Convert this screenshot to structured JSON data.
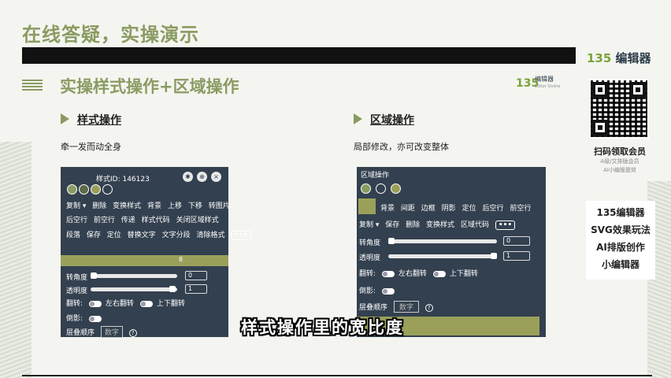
{
  "header": {
    "title": "在线答疑，实操演示"
  },
  "brand": {
    "num": "135",
    "name": "编辑器"
  },
  "section": {
    "title": "实操样式操作+区域操作"
  },
  "mini_logo": {
    "num": "135",
    "name": "编辑器",
    "en": "Editor Online"
  },
  "qr": {
    "caption": "扫码领取会员",
    "sub1": "A级/文排版会员",
    "sub2": "AI小编版提效"
  },
  "features": [
    "135编辑器",
    "SVG效果玩法",
    "AI排版创作",
    "小编辑器"
  ],
  "left": {
    "heading": "样式操作",
    "desc": "牵一发而动全身",
    "panel": {
      "style_id": "样式ID: 146123",
      "row1": [
        "复制 ▾",
        "删除",
        "变换样式",
        "背景",
        "上移",
        "下移",
        "转图片"
      ],
      "row2": [
        "后空行",
        "前空行",
        "传递",
        "样式代码",
        "关闭区域样式"
      ],
      "row3": [
        "段落",
        "保存",
        "定位",
        "替换文字",
        "文字分段",
        "清除格式"
      ],
      "more": "•••",
      "olive_num": "8",
      "rotate_label": "转角度",
      "rotate_value": "0",
      "opacity_label": "透明度",
      "opacity_value": "1",
      "flip_label": "翻转:",
      "flip_lr": "左右翻转",
      "flip_ud": "上下翻转",
      "reflect_label": "倒影:",
      "layer_label": "层叠顺序",
      "layer_placeholder": "数字",
      "help": "?"
    }
  },
  "right": {
    "heading": "区域操作",
    "desc": "局部修改，亦可改变整体",
    "panel": {
      "title": "区域操作",
      "row1": [
        "背景",
        "间距",
        "边框",
        "阴影",
        "定位",
        "后空行",
        "前空行"
      ],
      "row2": [
        "复制 ▾",
        "保存",
        "删除",
        "变换样式",
        "区域代码"
      ],
      "more": "•••",
      "rotate_label": "转角度",
      "rotate_value": "0",
      "opacity_label": "透明度",
      "opacity_value": "1",
      "flip_label": "翻转:",
      "flip_lr": "左右翻转",
      "flip_ud": "上下翻转",
      "reflect_label": "倒影:",
      "layer_label": "层叠顺序",
      "layer_placeholder": "数字",
      "help": "?"
    }
  },
  "subtitle": "样式操作里的宽比度",
  "colors": {
    "accent": "#8a9b62",
    "panel": "#33404f",
    "olive": "#9aa05a",
    "brand_green": "#7aa33a"
  }
}
